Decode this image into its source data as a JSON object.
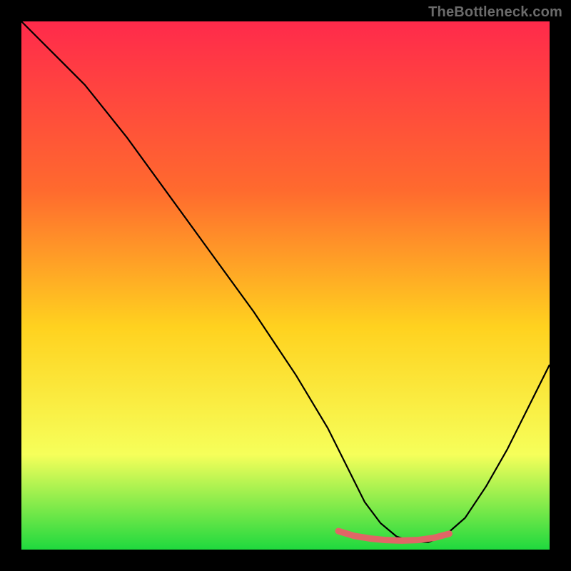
{
  "watermark": "TheBottleneck.com",
  "colors": {
    "background": "#000000",
    "gradient_top": "#ff2a4b",
    "gradient_mid1": "#ff6a2e",
    "gradient_mid2": "#ffd21f",
    "gradient_mid3": "#f6ff5a",
    "gradient_bottom": "#1fd93e",
    "curve": "#000000",
    "marker": "#e06666",
    "watermark": "#6b6b6b"
  },
  "chart_data": {
    "type": "line",
    "title": "",
    "xlabel": "",
    "ylabel": "",
    "xlim": [
      0,
      100
    ],
    "ylim": [
      0,
      100
    ],
    "grid": false,
    "series": [
      {
        "name": "bottleneck-curve",
        "x": [
          0,
          4,
          8,
          12,
          20,
          28,
          36,
          44,
          52,
          58,
          62,
          65,
          68,
          71,
          74,
          77,
          80,
          84,
          88,
          92,
          96,
          100
        ],
        "values": [
          100,
          96,
          92,
          88,
          78,
          67,
          56,
          45,
          33,
          23,
          15,
          9,
          5,
          2.5,
          1.5,
          1.4,
          2.5,
          6,
          12,
          19,
          27,
          35
        ]
      }
    ],
    "markers": {
      "name": "highlight-band",
      "x": [
        60,
        63,
        66,
        69,
        72,
        75,
        78,
        81
      ],
      "values": [
        3.5,
        2.6,
        2.1,
        1.8,
        1.7,
        1.8,
        2.2,
        3.0
      ]
    },
    "annotations": []
  }
}
